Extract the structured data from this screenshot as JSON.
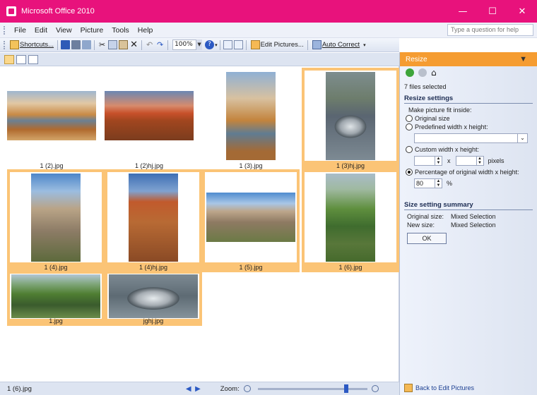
{
  "window": {
    "title": "Microsoft Office 2010",
    "controls": [
      "—",
      "☐",
      "✕"
    ]
  },
  "menu": {
    "items": [
      "File",
      "Edit",
      "View",
      "Picture",
      "Tools",
      "Help"
    ],
    "help_placeholder": "Type a question for help"
  },
  "toolbar": {
    "shortcuts": "Shortcuts...",
    "zoom": "100%",
    "edit_pictures": "Edit Pictures...",
    "auto_correct": "Auto Correct"
  },
  "thumbnails": [
    {
      "caption": "1 (2).jpg",
      "selected": false
    },
    {
      "caption": "1 (2)hj.jpg",
      "selected": false
    },
    {
      "caption": "1 (3).jpg",
      "selected": false
    },
    {
      "caption": "1 (3)hj.jpg",
      "selected": true
    },
    {
      "caption": "1 (4).jpg",
      "selected": true
    },
    {
      "caption": "1 (4)hj.jpg",
      "selected": true
    },
    {
      "caption": "1 (5).jpg",
      "selected": true
    },
    {
      "caption": "1 (6).jpg",
      "selected": true
    },
    {
      "caption": "1.jpg",
      "selected": true
    },
    {
      "caption": "jghj.jpg",
      "selected": true
    }
  ],
  "status": {
    "file": "1 (6).jpg",
    "zoom_label": "Zoom:"
  },
  "pane": {
    "title": "Resize",
    "files_selected": "7 files selected",
    "settings_title": "Resize settings",
    "fit_label": "Make picture fit inside:",
    "opt_original": "Original size",
    "opt_predefined": "Predefined width x height:",
    "opt_custom": "Custom width x height:",
    "x_label": "x",
    "pixels_label": "pixels",
    "opt_percentage": "Percentage of original width x height:",
    "percentage_value": "80",
    "percent_sign": "%",
    "summary_title": "Size setting summary",
    "original_size_label": "Original size:",
    "original_size_value": "Mixed Selection",
    "new_size_label": "New size:",
    "new_size_value": "Mixed Selection",
    "ok": "OK",
    "back": "Back to Edit Pictures"
  }
}
